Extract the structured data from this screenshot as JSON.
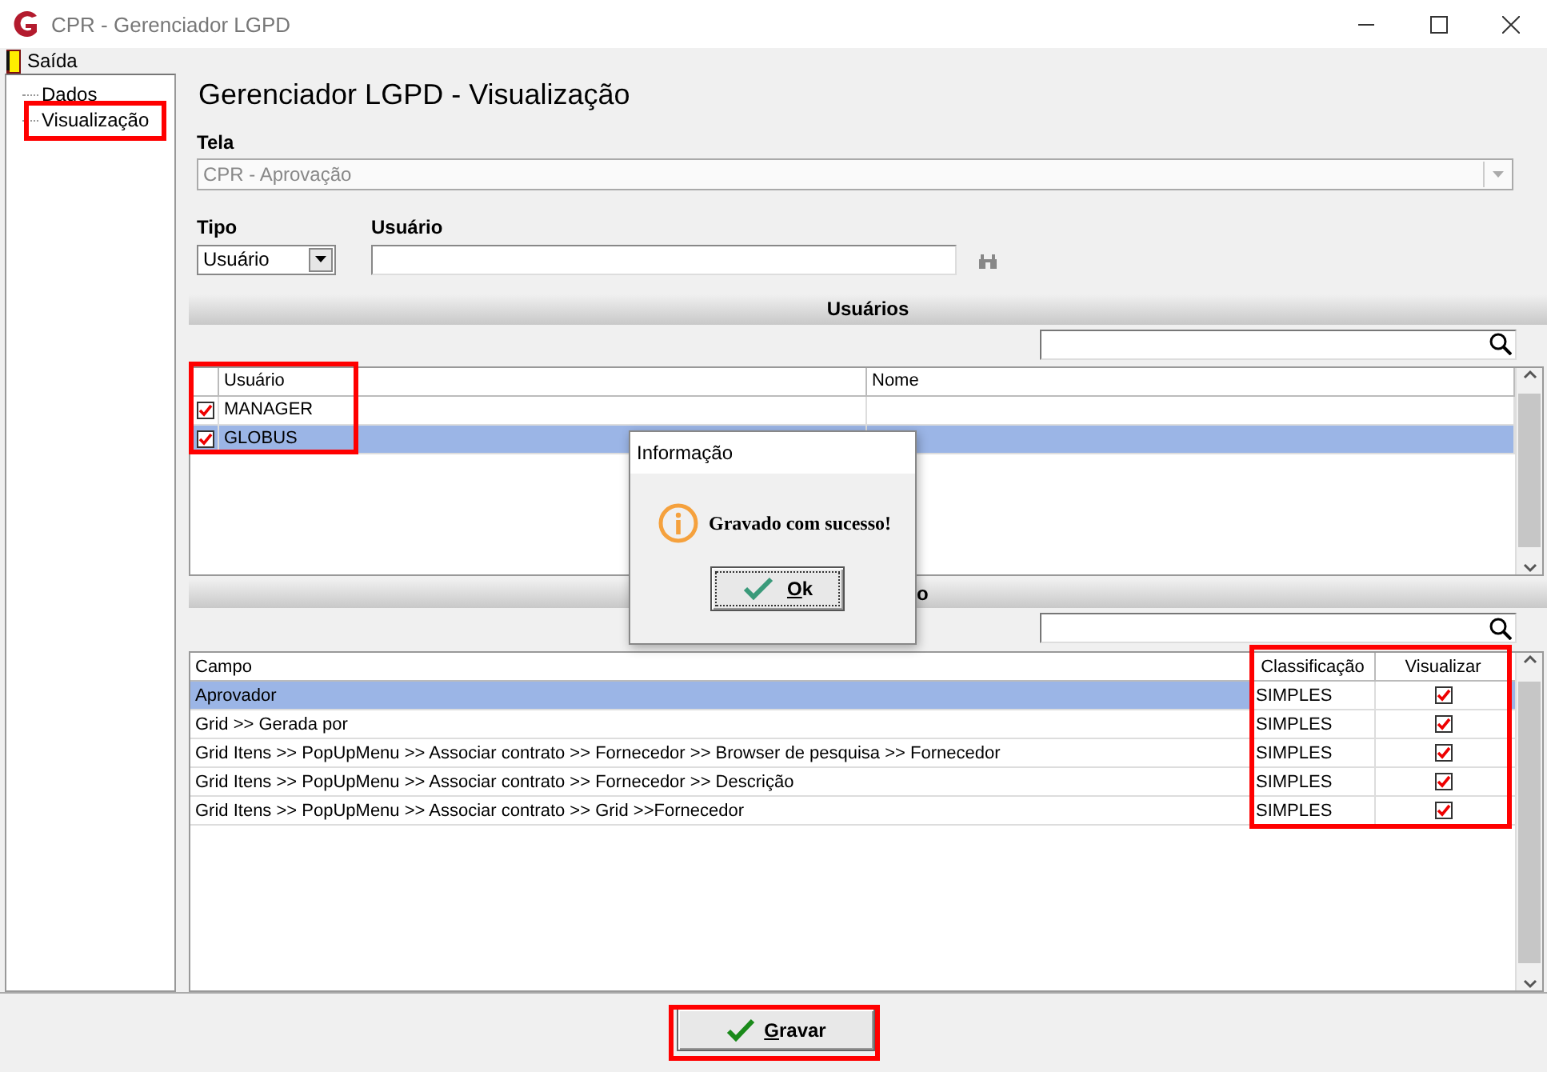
{
  "window": {
    "title": "CPR - Gerenciador LGPD"
  },
  "menu": [
    {
      "label": "Saída"
    }
  ],
  "tree": [
    {
      "label": "Dados"
    },
    {
      "label": "Visualização"
    }
  ],
  "heading": "Gerenciador LGPD - Visualização",
  "tela": {
    "label": "Tela",
    "value": "CPR - Aprovação",
    "disabled": true
  },
  "tipo": {
    "label": "Tipo",
    "value": "Usuário"
  },
  "usuario": {
    "label": "Usuário"
  },
  "users_section": {
    "title": "Usuários",
    "columns": [
      "Usuário",
      "Nome"
    ],
    "rows": [
      {
        "usuario": "MANAGER",
        "checked": true,
        "selected": false
      },
      {
        "usuario": "GLOBUS",
        "checked": true,
        "selected": true
      }
    ]
  },
  "fields_section": {
    "title": "o",
    "columns": [
      "Campo",
      "Classificação",
      "Visualizar"
    ],
    "rows": [
      {
        "campo": "Aprovador",
        "classificacao": "SIMPLES",
        "visualizar": true,
        "selected": true
      },
      {
        "campo": "Grid >> Gerada por",
        "classificacao": "SIMPLES",
        "visualizar": true,
        "selected": false
      },
      {
        "campo": "Grid Itens >> PopUpMenu >> Associar contrato >> Fornecedor >> Browser de pesquisa >> Fornecedor",
        "classificacao": "SIMPLES",
        "visualizar": true,
        "selected": false
      },
      {
        "campo": "Grid Itens >> PopUpMenu >> Associar contrato >> Fornecedor >> Descrição",
        "classificacao": "SIMPLES",
        "visualizar": true,
        "selected": false
      },
      {
        "campo": "Grid Itens >> PopUpMenu >> Associar contrato >> Grid >>Fornecedor",
        "classificacao": "SIMPLES",
        "visualizar": true,
        "selected": false
      }
    ]
  },
  "dialog": {
    "title": "Informação",
    "message": "Gravado com sucesso!",
    "button": "Ok"
  },
  "save_button": "Gravar"
}
